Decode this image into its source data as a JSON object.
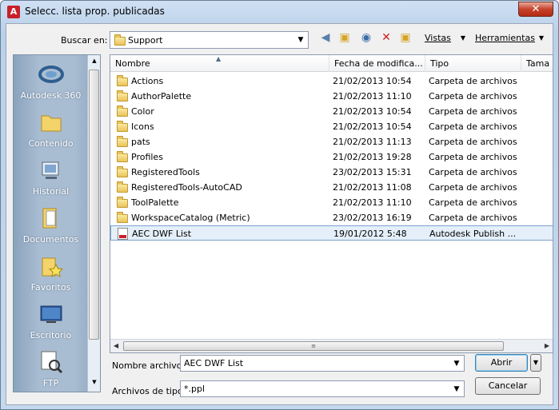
{
  "window": {
    "title": "Selecc. lista prop. publicadas",
    "close_label": "✕"
  },
  "lookin": {
    "label": "Buscar en:",
    "label_key": "e",
    "value": "Support"
  },
  "toolbar": {
    "views_label": "Vistas",
    "tools_label": "Herramientas"
  },
  "places": [
    {
      "label": "Autodesk 360",
      "icon": "autodesk-360-icon"
    },
    {
      "label": "Contenido",
      "icon": "folder-icon"
    },
    {
      "label": "Historial",
      "icon": "history-icon"
    },
    {
      "label": "Documentos",
      "icon": "documents-icon"
    },
    {
      "label": "Favoritos",
      "icon": "favorites-icon"
    },
    {
      "label": "Escritorio",
      "icon": "desktop-icon"
    },
    {
      "label": "FTP",
      "icon": "ftp-icon"
    }
  ],
  "columns": [
    "Nombre",
    "Fecha de modifica...",
    "Tipo",
    "Tama"
  ],
  "files": [
    {
      "name": "Actions",
      "date": "21/02/2013 10:54",
      "type": "Carpeta de archivos"
    },
    {
      "name": "AuthorPalette",
      "date": "21/02/2013 11:10",
      "type": "Carpeta de archivos"
    },
    {
      "name": "Color",
      "date": "21/02/2013 10:54",
      "type": "Carpeta de archivos"
    },
    {
      "name": "Icons",
      "date": "21/02/2013 10:54",
      "type": "Carpeta de archivos"
    },
    {
      "name": "pats",
      "date": "21/02/2013 11:13",
      "type": "Carpeta de archivos"
    },
    {
      "name": "Profiles",
      "date": "21/02/2013 19:28",
      "type": "Carpeta de archivos"
    },
    {
      "name": "RegisteredTools",
      "date": "23/02/2013 15:31",
      "type": "Carpeta de archivos"
    },
    {
      "name": "RegisteredTools-AutoCAD",
      "date": "21/02/2013 11:08",
      "type": "Carpeta de archivos"
    },
    {
      "name": "ToolPalette",
      "date": "21/02/2013 11:10",
      "type": "Carpeta de archivos"
    },
    {
      "name": "WorkspaceCatalog (Metric)",
      "date": "23/02/2013 16:19",
      "type": "Carpeta de archivos"
    },
    {
      "name": "AEC DWF List",
      "date": "19/01/2012 5:48",
      "type": "Autodesk Publish ...",
      "selected": true
    }
  ],
  "filename": {
    "label": "Nombre archivo:",
    "value": "AEC DWF List"
  },
  "filetype": {
    "label": "Archivos de tipo:",
    "value": "*.ppl"
  },
  "buttons": {
    "open": "Abrir",
    "cancel": "Cancelar"
  },
  "colors": {
    "selection": "#e4eff9",
    "accent": "#c8202b"
  }
}
